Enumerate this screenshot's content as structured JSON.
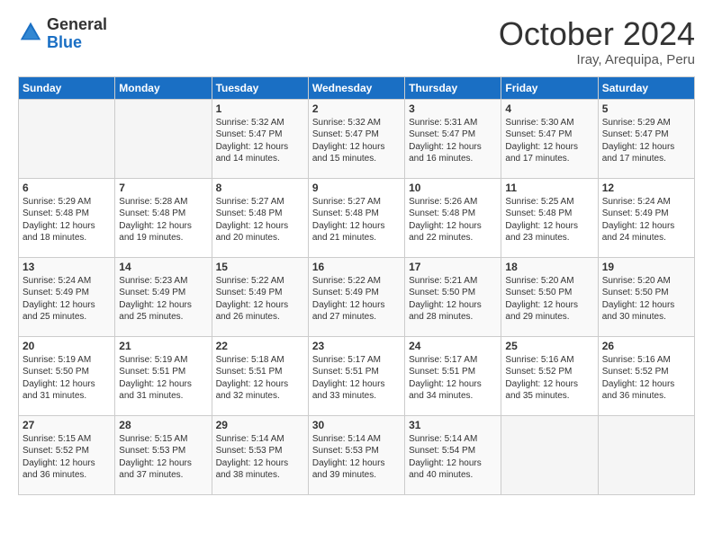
{
  "header": {
    "logo_general": "General",
    "logo_blue": "Blue",
    "month_title": "October 2024",
    "location": "Iray, Arequipa, Peru"
  },
  "weekdays": [
    "Sunday",
    "Monday",
    "Tuesday",
    "Wednesday",
    "Thursday",
    "Friday",
    "Saturday"
  ],
  "weeks": [
    [
      {
        "day": "",
        "sunrise": "",
        "sunset": "",
        "daylight": ""
      },
      {
        "day": "",
        "sunrise": "",
        "sunset": "",
        "daylight": ""
      },
      {
        "day": "1",
        "sunrise": "Sunrise: 5:32 AM",
        "sunset": "Sunset: 5:47 PM",
        "daylight": "Daylight: 12 hours and 14 minutes."
      },
      {
        "day": "2",
        "sunrise": "Sunrise: 5:32 AM",
        "sunset": "Sunset: 5:47 PM",
        "daylight": "Daylight: 12 hours and 15 minutes."
      },
      {
        "day": "3",
        "sunrise": "Sunrise: 5:31 AM",
        "sunset": "Sunset: 5:47 PM",
        "daylight": "Daylight: 12 hours and 16 minutes."
      },
      {
        "day": "4",
        "sunrise": "Sunrise: 5:30 AM",
        "sunset": "Sunset: 5:47 PM",
        "daylight": "Daylight: 12 hours and 17 minutes."
      },
      {
        "day": "5",
        "sunrise": "Sunrise: 5:29 AM",
        "sunset": "Sunset: 5:47 PM",
        "daylight": "Daylight: 12 hours and 17 minutes."
      }
    ],
    [
      {
        "day": "6",
        "sunrise": "Sunrise: 5:29 AM",
        "sunset": "Sunset: 5:48 PM",
        "daylight": "Daylight: 12 hours and 18 minutes."
      },
      {
        "day": "7",
        "sunrise": "Sunrise: 5:28 AM",
        "sunset": "Sunset: 5:48 PM",
        "daylight": "Daylight: 12 hours and 19 minutes."
      },
      {
        "day": "8",
        "sunrise": "Sunrise: 5:27 AM",
        "sunset": "Sunset: 5:48 PM",
        "daylight": "Daylight: 12 hours and 20 minutes."
      },
      {
        "day": "9",
        "sunrise": "Sunrise: 5:27 AM",
        "sunset": "Sunset: 5:48 PM",
        "daylight": "Daylight: 12 hours and 21 minutes."
      },
      {
        "day": "10",
        "sunrise": "Sunrise: 5:26 AM",
        "sunset": "Sunset: 5:48 PM",
        "daylight": "Daylight: 12 hours and 22 minutes."
      },
      {
        "day": "11",
        "sunrise": "Sunrise: 5:25 AM",
        "sunset": "Sunset: 5:48 PM",
        "daylight": "Daylight: 12 hours and 23 minutes."
      },
      {
        "day": "12",
        "sunrise": "Sunrise: 5:24 AM",
        "sunset": "Sunset: 5:49 PM",
        "daylight": "Daylight: 12 hours and 24 minutes."
      }
    ],
    [
      {
        "day": "13",
        "sunrise": "Sunrise: 5:24 AM",
        "sunset": "Sunset: 5:49 PM",
        "daylight": "Daylight: 12 hours and 25 minutes."
      },
      {
        "day": "14",
        "sunrise": "Sunrise: 5:23 AM",
        "sunset": "Sunset: 5:49 PM",
        "daylight": "Daylight: 12 hours and 25 minutes."
      },
      {
        "day": "15",
        "sunrise": "Sunrise: 5:22 AM",
        "sunset": "Sunset: 5:49 PM",
        "daylight": "Daylight: 12 hours and 26 minutes."
      },
      {
        "day": "16",
        "sunrise": "Sunrise: 5:22 AM",
        "sunset": "Sunset: 5:49 PM",
        "daylight": "Daylight: 12 hours and 27 minutes."
      },
      {
        "day": "17",
        "sunrise": "Sunrise: 5:21 AM",
        "sunset": "Sunset: 5:50 PM",
        "daylight": "Daylight: 12 hours and 28 minutes."
      },
      {
        "day": "18",
        "sunrise": "Sunrise: 5:20 AM",
        "sunset": "Sunset: 5:50 PM",
        "daylight": "Daylight: 12 hours and 29 minutes."
      },
      {
        "day": "19",
        "sunrise": "Sunrise: 5:20 AM",
        "sunset": "Sunset: 5:50 PM",
        "daylight": "Daylight: 12 hours and 30 minutes."
      }
    ],
    [
      {
        "day": "20",
        "sunrise": "Sunrise: 5:19 AM",
        "sunset": "Sunset: 5:50 PM",
        "daylight": "Daylight: 12 hours and 31 minutes."
      },
      {
        "day": "21",
        "sunrise": "Sunrise: 5:19 AM",
        "sunset": "Sunset: 5:51 PM",
        "daylight": "Daylight: 12 hours and 31 minutes."
      },
      {
        "day": "22",
        "sunrise": "Sunrise: 5:18 AM",
        "sunset": "Sunset: 5:51 PM",
        "daylight": "Daylight: 12 hours and 32 minutes."
      },
      {
        "day": "23",
        "sunrise": "Sunrise: 5:17 AM",
        "sunset": "Sunset: 5:51 PM",
        "daylight": "Daylight: 12 hours and 33 minutes."
      },
      {
        "day": "24",
        "sunrise": "Sunrise: 5:17 AM",
        "sunset": "Sunset: 5:51 PM",
        "daylight": "Daylight: 12 hours and 34 minutes."
      },
      {
        "day": "25",
        "sunrise": "Sunrise: 5:16 AM",
        "sunset": "Sunset: 5:52 PM",
        "daylight": "Daylight: 12 hours and 35 minutes."
      },
      {
        "day": "26",
        "sunrise": "Sunrise: 5:16 AM",
        "sunset": "Sunset: 5:52 PM",
        "daylight": "Daylight: 12 hours and 36 minutes."
      }
    ],
    [
      {
        "day": "27",
        "sunrise": "Sunrise: 5:15 AM",
        "sunset": "Sunset: 5:52 PM",
        "daylight": "Daylight: 12 hours and 36 minutes."
      },
      {
        "day": "28",
        "sunrise": "Sunrise: 5:15 AM",
        "sunset": "Sunset: 5:53 PM",
        "daylight": "Daylight: 12 hours and 37 minutes."
      },
      {
        "day": "29",
        "sunrise": "Sunrise: 5:14 AM",
        "sunset": "Sunset: 5:53 PM",
        "daylight": "Daylight: 12 hours and 38 minutes."
      },
      {
        "day": "30",
        "sunrise": "Sunrise: 5:14 AM",
        "sunset": "Sunset: 5:53 PM",
        "daylight": "Daylight: 12 hours and 39 minutes."
      },
      {
        "day": "31",
        "sunrise": "Sunrise: 5:14 AM",
        "sunset": "Sunset: 5:54 PM",
        "daylight": "Daylight: 12 hours and 40 minutes."
      },
      {
        "day": "",
        "sunrise": "",
        "sunset": "",
        "daylight": ""
      },
      {
        "day": "",
        "sunrise": "",
        "sunset": "",
        "daylight": ""
      }
    ]
  ]
}
